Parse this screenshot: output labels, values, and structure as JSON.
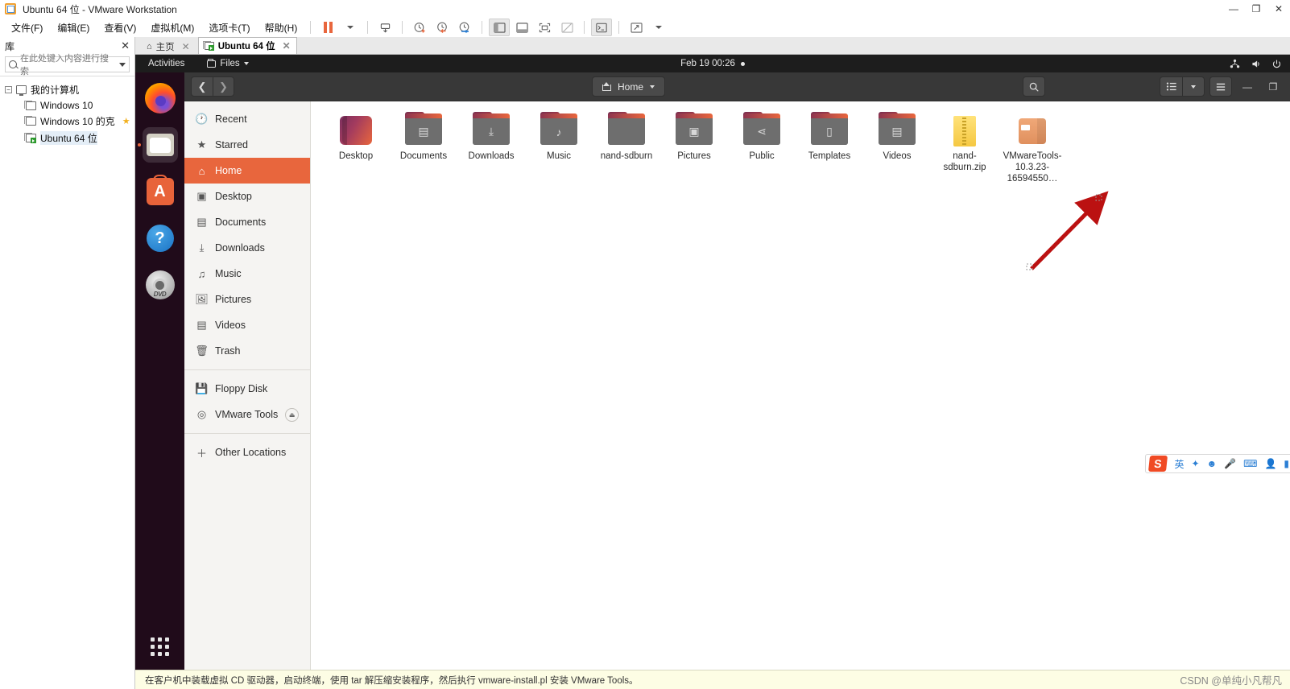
{
  "window": {
    "title": "Ubuntu 64 位 - VMware Workstation",
    "controls": {
      "minimize": "—",
      "maximize": "❐",
      "close": "✕"
    }
  },
  "menubar": {
    "items": [
      {
        "label": "文件(F)",
        "name": "menu-file"
      },
      {
        "label": "编辑(E)",
        "name": "menu-edit"
      },
      {
        "label": "查看(V)",
        "name": "menu-view"
      },
      {
        "label": "虚拟机(M)",
        "name": "menu-vm"
      },
      {
        "label": "选项卡(T)",
        "name": "menu-tabs"
      },
      {
        "label": "帮助(H)",
        "name": "menu-help"
      }
    ]
  },
  "toolbar": {
    "icons": [
      {
        "name": "suspend-button",
        "glyph": "pause"
      },
      {
        "name": "suspend-dropdown",
        "glyph": "caret"
      },
      {
        "name": "power-options-button",
        "glyph": "⎙"
      },
      {
        "name": "snapshot-take-button",
        "glyph": "⏱"
      },
      {
        "name": "snapshot-revert-button",
        "glyph": "⏲"
      },
      {
        "name": "snapshot-manager-button",
        "glyph": "⏰"
      },
      {
        "name": "show-library-button",
        "glyph": "▥",
        "active": true
      },
      {
        "name": "show-thumbnail-bar-button",
        "glyph": "▤"
      },
      {
        "name": "fullscreen-button",
        "glyph": "⛶"
      },
      {
        "name": "unity-mode-button",
        "glyph": "⧄"
      },
      {
        "name": "console-button",
        "glyph": "▣",
        "active": true
      },
      {
        "name": "stretch-button",
        "glyph": "⤢"
      },
      {
        "name": "stretch-dropdown",
        "glyph": "caret"
      }
    ]
  },
  "library": {
    "title": "库",
    "close_label": "✕",
    "search_placeholder": "在此处键入内容进行搜索",
    "tree": [
      {
        "label": "我的计算机",
        "type": "root",
        "expanded": true,
        "starred": false
      },
      {
        "label": "Windows 10",
        "type": "vm",
        "starred": false,
        "running": false,
        "selected": false
      },
      {
        "label": "Windows 10 的克",
        "type": "vm",
        "starred": true,
        "running": false,
        "selected": false
      },
      {
        "label": "Ubuntu 64 位",
        "type": "vm",
        "starred": false,
        "running": true,
        "selected": true
      }
    ]
  },
  "tabs": [
    {
      "label": "主页",
      "icon": "home-icon",
      "active": false,
      "close": "✕"
    },
    {
      "label": "Ubuntu 64 位",
      "icon": "vm-icon",
      "active": true,
      "close": "✕"
    }
  ],
  "guest": {
    "topbar": {
      "activities": "Activities",
      "app_menu": "Files",
      "clock": "Feb 19  00:26",
      "indicators": [
        "network-icon",
        "volume-icon",
        "power-icon"
      ]
    },
    "dock": [
      {
        "name": "dock-item-firefox",
        "label": "Firefox"
      },
      {
        "name": "dock-item-files",
        "label": "Files",
        "running": true
      },
      {
        "name": "dock-item-software",
        "label": "Ubuntu Software"
      },
      {
        "name": "dock-item-help",
        "label": "Help"
      },
      {
        "name": "dock-item-dvd",
        "label": "VMware Tools"
      },
      {
        "name": "dock-item-show-apps",
        "label": "Show Applications"
      }
    ],
    "nautilus": {
      "nav": {
        "back": "❮",
        "forward": "❯"
      },
      "path_label": "Home",
      "search_icon": "search-icon",
      "view_list_icon": "list-view-icon",
      "view_dropdown_icon": "chevron-down-icon",
      "menu_icon": "hamburger-menu-icon",
      "minimize": "—",
      "maximize": "❐",
      "places": [
        {
          "label": "Recent",
          "icon": "clock-icon",
          "active": false
        },
        {
          "label": "Starred",
          "icon": "star-icon",
          "active": false
        },
        {
          "label": "Home",
          "icon": "home-icon",
          "active": true
        },
        {
          "label": "Desktop",
          "icon": "desktop-icon",
          "active": false
        },
        {
          "label": "Documents",
          "icon": "document-icon",
          "active": false
        },
        {
          "label": "Downloads",
          "icon": "download-icon",
          "active": false
        },
        {
          "label": "Music",
          "icon": "music-icon",
          "active": false
        },
        {
          "label": "Pictures",
          "icon": "picture-icon",
          "active": false
        },
        {
          "label": "Videos",
          "icon": "video-icon",
          "active": false
        },
        {
          "label": "Trash",
          "icon": "trash-icon",
          "active": false
        }
      ],
      "devices": [
        {
          "label": "Floppy Disk",
          "icon": "floppy-icon",
          "eject": false
        },
        {
          "label": "VMware Tools",
          "icon": "disc-icon",
          "eject": true,
          "eject_glyph": "⏏"
        }
      ],
      "other_locations": {
        "label": "Other Locations",
        "icon": "plus-icon"
      },
      "files": [
        {
          "label": "Desktop",
          "type": "desktop",
          "selected": false
        },
        {
          "label": "Documents",
          "type": "folder",
          "glyph": "▤",
          "selected": false
        },
        {
          "label": "Downloads",
          "type": "folder",
          "glyph": "⤓",
          "selected": false
        },
        {
          "label": "Music",
          "type": "folder",
          "glyph": "♪",
          "selected": false
        },
        {
          "label": "nand-sdburn",
          "type": "folder",
          "glyph": "",
          "selected": false
        },
        {
          "label": "Pictures",
          "type": "folder",
          "glyph": "▣",
          "selected": false
        },
        {
          "label": "Public",
          "type": "folder",
          "glyph": "⋖",
          "selected": false
        },
        {
          "label": "Templates",
          "type": "folder",
          "glyph": "▯",
          "selected": false
        },
        {
          "label": "Videos",
          "type": "folder",
          "glyph": "▤",
          "selected": false
        },
        {
          "label": "nand-sdburn.zip",
          "type": "zip",
          "selected": false
        },
        {
          "label": "VMwareTools-10.3.23-16594550…",
          "type": "archive",
          "selected": false,
          "highlighted": true
        }
      ]
    },
    "ime": {
      "logo": "S",
      "mode": "英",
      "items": [
        "英",
        "✦",
        "☻",
        "🎤",
        "⌨",
        "👤",
        "▮"
      ]
    }
  },
  "statusbar": {
    "message": "在客户机中装载虚拟 CD 驱动器，启动终端，使用 tar 解压缩安装程序，然后执行 vmware-install.pl 安装 VMware Tools。",
    "watermark": "CSDN @单纯小凡帮凡"
  }
}
